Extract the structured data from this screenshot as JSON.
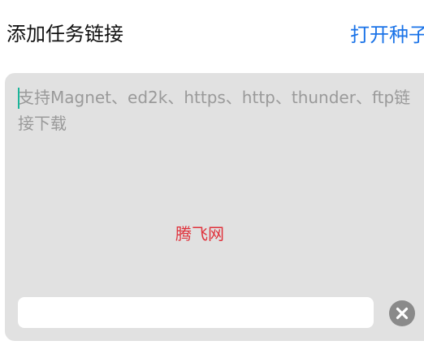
{
  "header": {
    "title": "添加任务链接",
    "open_torrent_label": "打开种子"
  },
  "link_input": {
    "placeholder": "支持Magnet、ed2k、https、http、thunder、ftp链接下载"
  },
  "watermark": {
    "text": "腾飞网"
  },
  "icons": {
    "clear": "close-circle-icon"
  },
  "colors": {
    "accent": "#1a73e8",
    "caret": "#1bb59a",
    "watermark": "#e0323c",
    "card_background": "#e1e1e1"
  }
}
